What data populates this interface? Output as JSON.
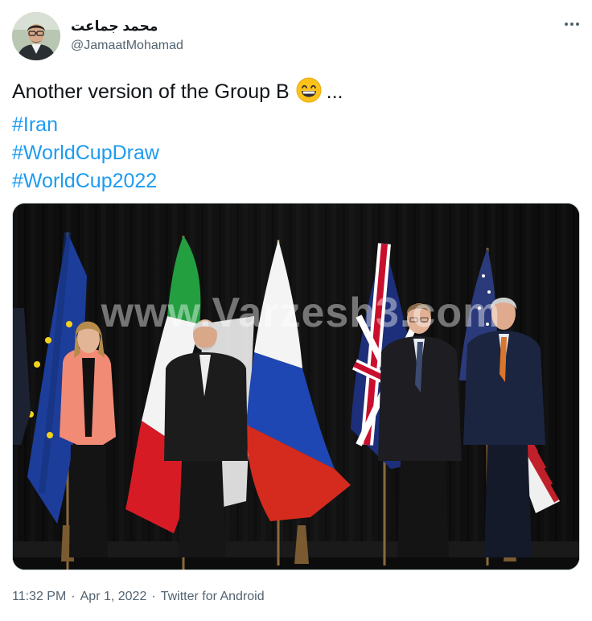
{
  "author": {
    "name": "محمد جماعت",
    "handle": "@JamaatMohamad",
    "avatar_icon": "profile-photo-man-with-glasses"
  },
  "more_icon": "ellipsis-icon",
  "tweet": {
    "text_line1": "Another version of the Group B",
    "emoji": "grinning-face-with-smiling-eyes",
    "ellipsis": "...",
    "hashtags": [
      "#Iran",
      "#WorldCupDraw",
      "#WorldCup2022"
    ]
  },
  "media": {
    "watermark": "www.Varzesh3.com",
    "description_icons": [
      "eu-flag",
      "iran-flag",
      "russia-flag",
      "uk-flag",
      "usa-flag"
    ]
  },
  "meta": {
    "time": "11:32 PM",
    "date": "Apr 1, 2022",
    "source": "Twitter for Android"
  },
  "colors": {
    "link": "#1d9bf0",
    "secondary_text": "#536471",
    "primary_text": "#0f1419"
  }
}
